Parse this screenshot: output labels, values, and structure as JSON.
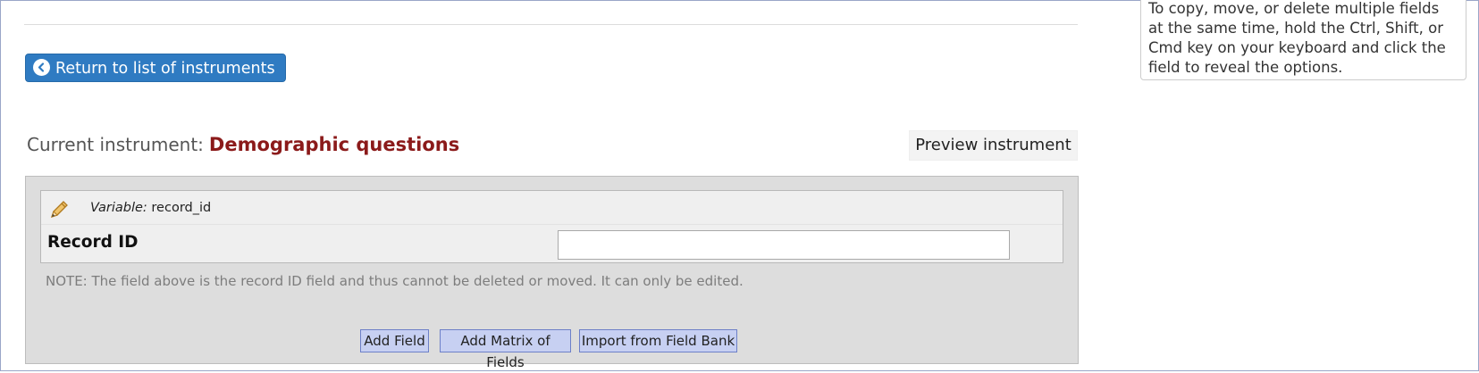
{
  "help": {
    "text": "To copy, move, or delete multiple fields at the same time, hold the Ctrl, Shift, or Cmd key on your keyboard and click the field to reveal the options."
  },
  "nav": {
    "return_label": "Return to list of instruments",
    "return_icon": "chevron-left-circle-icon"
  },
  "instrument": {
    "current_label": "Current instrument:",
    "name": "Demographic questions",
    "name_color": "#8b1a1a",
    "preview_label": "Preview instrument"
  },
  "field": {
    "edit_icon": "pencil-icon",
    "variable_label": "Variable:",
    "variable_name": "record_id",
    "label": "Record ID",
    "value": ""
  },
  "note": "NOTE: The field above is the record ID field and thus cannot be deleted or moved. It can only be edited.",
  "actions": {
    "add_field": "Add Field",
    "add_matrix": "Add Matrix of Fields",
    "import_bank": "Import from Field Bank"
  },
  "colors": {
    "primary_button": "#2f7bc2",
    "action_button": "#c7d0f2",
    "panel_bg": "#dddddd"
  }
}
